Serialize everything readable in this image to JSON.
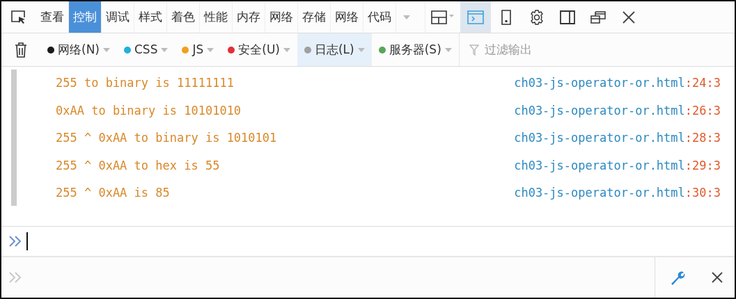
{
  "tabs": [
    {
      "label": "查看",
      "selected": false
    },
    {
      "label": "控制",
      "selected": true
    },
    {
      "label": "调试",
      "selected": false
    },
    {
      "label": "样式",
      "selected": false
    },
    {
      "label": "着色",
      "selected": false
    },
    {
      "label": "性能",
      "selected": false
    },
    {
      "label": "内存",
      "selected": false
    },
    {
      "label": "网络",
      "selected": false
    },
    {
      "label": "存储",
      "selected": false
    },
    {
      "label": "网络",
      "selected": false
    },
    {
      "label": "代码",
      "selected": false
    }
  ],
  "toolbar_tools": [
    {
      "kind": "layout",
      "selected": false
    },
    {
      "kind": "console",
      "selected": true
    },
    {
      "kind": "phone",
      "selected": false
    },
    {
      "kind": "settings",
      "selected": false
    },
    {
      "kind": "dock",
      "selected": false
    },
    {
      "kind": "popout",
      "selected": false
    },
    {
      "kind": "close",
      "selected": false
    }
  ],
  "filters": [
    {
      "label": "网络(N)",
      "color": "#1a1a1a",
      "selected": false
    },
    {
      "label": "CSS",
      "color": "#1fb0dc",
      "selected": false
    },
    {
      "label": "JS",
      "color": "#f0a020",
      "selected": false
    },
    {
      "label": "安全(U)",
      "color": "#e0303a",
      "selected": false
    },
    {
      "label": "日志(L)",
      "color": "#a0a0a0",
      "selected": true
    },
    {
      "label": "服务器(S)",
      "color": "#5aa55a",
      "selected": false
    }
  ],
  "filter_field": {
    "placeholder": "过滤输出"
  },
  "log": [
    {
      "message": "255 to binary is 11111111",
      "file": "ch03-js-operator-or.html",
      "location": ":24:3"
    },
    {
      "message": "0xAA to binary is 10101010",
      "file": "ch03-js-operator-or.html",
      "location": ":26:3"
    },
    {
      "message": "255 ^ 0xAA to binary is 1010101",
      "file": "ch03-js-operator-or.html",
      "location": ":28:3"
    },
    {
      "message": "255 ^ 0xAA to hex is 55",
      "file": "ch03-js-operator-or.html",
      "location": ":29:3"
    },
    {
      "message": "255 ^ 0xAA is 85",
      "file": "ch03-js-operator-or.html",
      "location": ":30:3"
    }
  ]
}
